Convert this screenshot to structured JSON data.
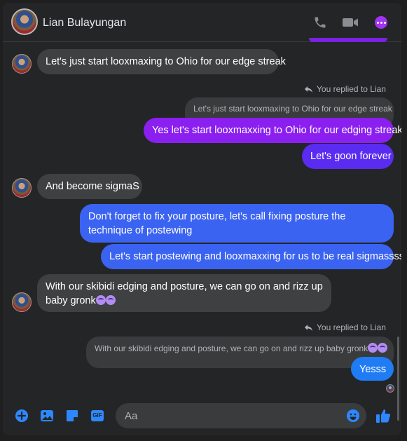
{
  "header": {
    "contact_name": "Lian Bulayungan",
    "icons": [
      "phone-icon",
      "video-camera-icon",
      "more-options-icon"
    ],
    "accent_color": "#a333f2"
  },
  "messages": [
    {
      "side": "in",
      "text": "Let's just start looxmaxing to Ohio for our edge streak"
    },
    {
      "side": "out",
      "reply_label": "You replied to Lian",
      "quoted_text": "Let's just start looxmaxing to Ohio for our edge streak",
      "text": "Yes let's start looxmaxxing to Ohio for our edging streak"
    },
    {
      "side": "out",
      "text": "Let's goon forever"
    },
    {
      "side": "in",
      "text": "And become sigmaS"
    },
    {
      "side": "out",
      "text": "Don't forget to fix your posture, let's call fixing posture the technique of postewing"
    },
    {
      "side": "out",
      "text": "Let's start postewing and looxmaxxing for us to be real sigmassss"
    },
    {
      "side": "in",
      "text": "With our skibidi edging and posture, we can go on and rizz up baby gronk"
    },
    {
      "side": "out",
      "reply_label": "You replied to Lian",
      "quoted_text": "With our skibidi edging and posture, we can go on and rizz up baby gronk",
      "text": "Yesss"
    }
  ],
  "composer": {
    "placeholder": "Aa",
    "icons": [
      "add-icon",
      "photo-icon",
      "sticker-icon",
      "gif-icon",
      "emoji-icon",
      "like-icon"
    ],
    "gif_label": "GIF"
  },
  "colors": {
    "bubble_incoming": "#3e4042",
    "bubble_outgoing_top": "#8a1ff0",
    "bubble_outgoing_bottom": "#1f7cf5",
    "messenger_blue": "#2d88ff"
  }
}
